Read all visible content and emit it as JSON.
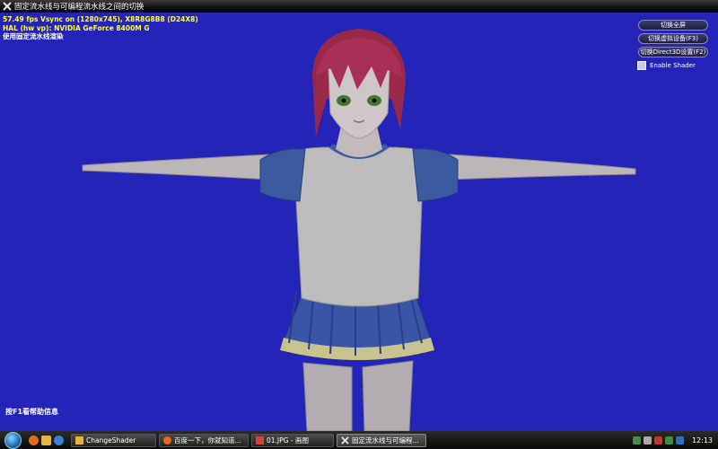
{
  "window": {
    "title": "固定流水线与可编程流水线之间的切换",
    "icon": "directx-icon"
  },
  "viewport": {
    "background": "#2424b8",
    "stats": {
      "line1": "57.49 fps Vsync on (1280x745), X8R8G8B8 (D24X8)",
      "line2": "HAL (hw vp): NVIDIA GeForce 8400M G",
      "line3": "使用固定流水线渲染"
    },
    "help": "按F1看帮助信息",
    "controls": {
      "fullscreen": "切换全屏",
      "ref_device": "切换虚拟设备(F3)",
      "d3d_settings": "切换Direct3D设置(F2)",
      "enable_shader_label": "Enable Shader",
      "enable_shader_checked": false
    }
  },
  "taskbar": {
    "start_icon": "windows-orb-icon",
    "quick_launch": [
      "browser-icon",
      "folder-icon",
      "media-icon"
    ],
    "tasks": [
      {
        "label": "ChangeShader",
        "icon": "folder-icon"
      },
      {
        "label": "百度一下，你就知道...",
        "icon": "firefox-icon"
      },
      {
        "label": "01.JPG - 画图",
        "icon": "paint-icon"
      },
      {
        "label": "固定流水线与可编程...",
        "icon": "directx-icon",
        "active": true
      }
    ],
    "tray_icons": [
      "network-icon",
      "volume-icon",
      "security-icon",
      "power-icon",
      "ime-icon"
    ],
    "clock": "12:13"
  }
}
